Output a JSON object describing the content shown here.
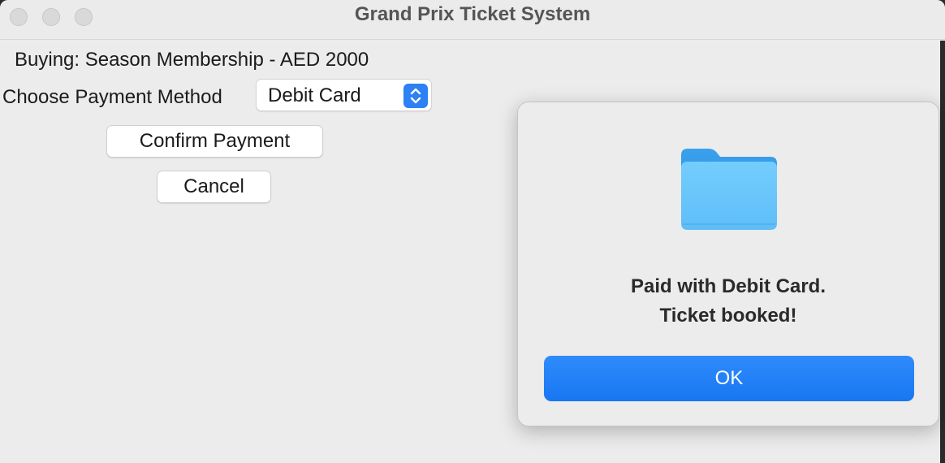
{
  "window": {
    "title": "Grand Prix Ticket System"
  },
  "main": {
    "buying_text": "Buying: Season Membership - AED 2000",
    "payment_label": "Choose Payment Method",
    "payment_selected": "Debit Card",
    "confirm_label": "Confirm Payment",
    "cancel_label": "Cancel"
  },
  "dialog": {
    "icon": "folder-icon",
    "message_line1": "Paid with Debit Card.",
    "message_line2": "Ticket booked!",
    "ok_label": "OK"
  },
  "colors": {
    "accent": "#1a7cf5",
    "window_bg": "#ececec"
  }
}
